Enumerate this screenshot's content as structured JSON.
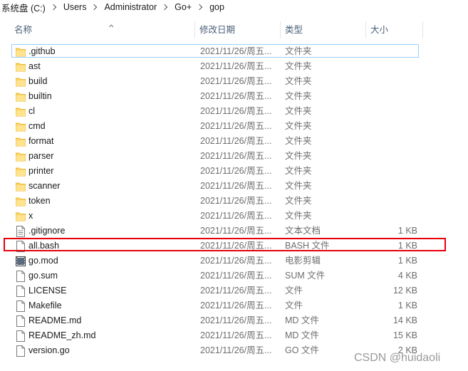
{
  "breadcrumb": [
    "系统盘 (C:)",
    "Users",
    "Administrator",
    "Go+",
    "gop"
  ],
  "columns": {
    "name": "名称",
    "date": "修改日期",
    "type": "类型",
    "size": "大小"
  },
  "files": [
    {
      "name": ".github",
      "date": "2021/11/26/周五...",
      "type": "文件夹",
      "size": "",
      "icon": "folder-icon"
    },
    {
      "name": "ast",
      "date": "2021/11/26/周五...",
      "type": "文件夹",
      "size": "",
      "icon": "folder-icon"
    },
    {
      "name": "build",
      "date": "2021/11/26/周五...",
      "type": "文件夹",
      "size": "",
      "icon": "folder-icon"
    },
    {
      "name": "builtin",
      "date": "2021/11/26/周五...",
      "type": "文件夹",
      "size": "",
      "icon": "folder-icon"
    },
    {
      "name": "cl",
      "date": "2021/11/26/周五...",
      "type": "文件夹",
      "size": "",
      "icon": "folder-icon"
    },
    {
      "name": "cmd",
      "date": "2021/11/26/周五...",
      "type": "文件夹",
      "size": "",
      "icon": "folder-icon"
    },
    {
      "name": "format",
      "date": "2021/11/26/周五...",
      "type": "文件夹",
      "size": "",
      "icon": "folder-icon"
    },
    {
      "name": "parser",
      "date": "2021/11/26/周五...",
      "type": "文件夹",
      "size": "",
      "icon": "folder-icon"
    },
    {
      "name": "printer",
      "date": "2021/11/26/周五...",
      "type": "文件夹",
      "size": "",
      "icon": "folder-icon"
    },
    {
      "name": "scanner",
      "date": "2021/11/26/周五...",
      "type": "文件夹",
      "size": "",
      "icon": "folder-icon"
    },
    {
      "name": "token",
      "date": "2021/11/26/周五...",
      "type": "文件夹",
      "size": "",
      "icon": "folder-icon"
    },
    {
      "name": "x",
      "date": "2021/11/26/周五...",
      "type": "文件夹",
      "size": "",
      "icon": "folder-icon"
    },
    {
      "name": ".gitignore",
      "date": "2021/11/26/周五...",
      "type": "文本文档",
      "size": "1 KB",
      "icon": "text-file-icon"
    },
    {
      "name": "all.bash",
      "date": "2021/11/26/周五...",
      "type": "BASH 文件",
      "size": "1 KB",
      "icon": "file-icon"
    },
    {
      "name": "go.mod",
      "date": "2021/11/26/周五...",
      "type": "电影剪辑",
      "size": "1 KB",
      "icon": "video-file-icon"
    },
    {
      "name": "go.sum",
      "date": "2021/11/26/周五...",
      "type": "SUM 文件",
      "size": "4 KB",
      "icon": "file-icon"
    },
    {
      "name": "LICENSE",
      "date": "2021/11/26/周五...",
      "type": "文件",
      "size": "12 KB",
      "icon": "file-icon"
    },
    {
      "name": "Makefile",
      "date": "2021/11/26/周五...",
      "type": "文件",
      "size": "1 KB",
      "icon": "file-icon"
    },
    {
      "name": "README.md",
      "date": "2021/11/26/周五...",
      "type": "MD 文件",
      "size": "14 KB",
      "icon": "file-icon"
    },
    {
      "name": "README_zh.md",
      "date": "2021/11/26/周五...",
      "type": "MD 文件",
      "size": "15 KB",
      "icon": "file-icon"
    },
    {
      "name": "version.go",
      "date": "2021/11/26/周五...",
      "type": "GO 文件",
      "size": "2 KB",
      "icon": "file-icon"
    }
  ],
  "focused_row": ".github",
  "highlighted_row": "all.bash",
  "colors": {
    "folder": "#ffd767",
    "highlight_border": "#e8000b",
    "focus_border": "#99d1ff",
    "header_text": "#4c607a"
  },
  "watermark": "CSDN @huidaoli"
}
